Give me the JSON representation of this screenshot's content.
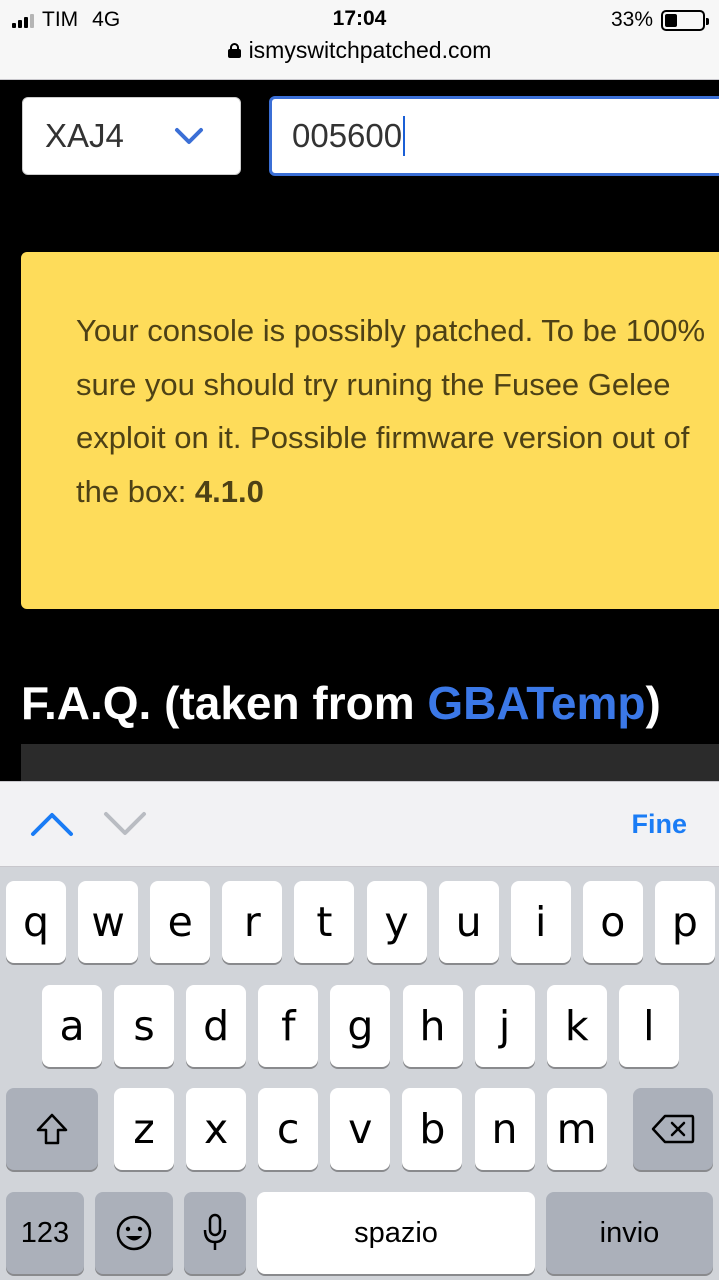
{
  "status_bar": {
    "carrier": "TIM",
    "network": "4G",
    "time": "17:04",
    "battery_percent": "33%",
    "battery_level": 0.33
  },
  "browser": {
    "url": "ismyswitchpatched.com"
  },
  "form": {
    "serial_prefix": "XAJ4",
    "serial_number": "005600"
  },
  "alert": {
    "message": "Your console is possibly patched. To be 100% sure you should try runing the Fusee Gelee exploit on it. Possible firmware version out of the box: ",
    "firmware_version": "4.1.0",
    "color": "#fedc5a"
  },
  "faq": {
    "heading_prefix": "F.A.Q. (taken from ",
    "link_text": "GBATemp",
    "heading_suffix": ")"
  },
  "keyboard_toolbar": {
    "done_label": "Fine"
  },
  "keyboard": {
    "row1": [
      "q",
      "w",
      "e",
      "r",
      "t",
      "y",
      "u",
      "i",
      "o",
      "p"
    ],
    "row2": [
      "a",
      "s",
      "d",
      "f",
      "g",
      "h",
      "j",
      "k",
      "l"
    ],
    "row3": [
      "z",
      "x",
      "c",
      "v",
      "b",
      "n",
      "m"
    ],
    "numbers_label": "123",
    "space_label": "spazio",
    "return_label": "invio",
    "icons": [
      "shift-icon",
      "backspace-icon",
      "emoji-icon",
      "microphone-icon",
      "chevron-up-icon",
      "chevron-down-icon"
    ]
  },
  "colors": {
    "accent": "#1a7cf5",
    "input_focus": "#3b6fd6",
    "link": "#3b78e7"
  }
}
